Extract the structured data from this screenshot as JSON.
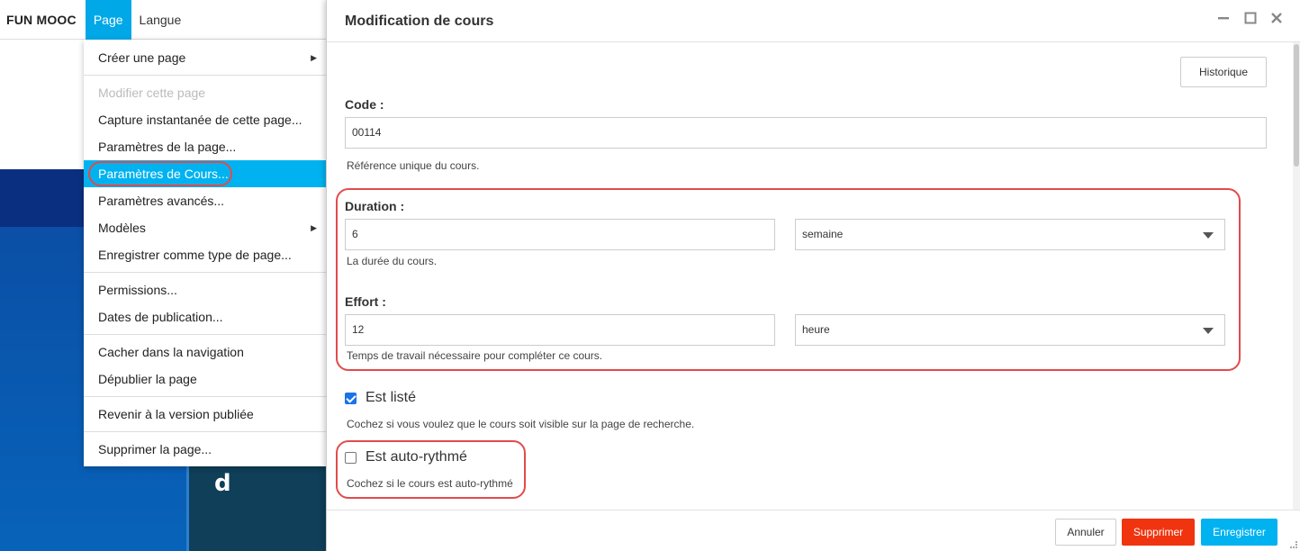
{
  "toolbar": {
    "brand": "FUN MOOC",
    "items": [
      {
        "label": "Page",
        "active": true
      },
      {
        "label": "Langue",
        "active": false
      }
    ]
  },
  "background": {
    "letter": "d"
  },
  "menu": {
    "items": [
      {
        "label": "Créer une page",
        "submenu": true
      },
      {
        "label": "Modifier cette page",
        "disabled": true
      },
      {
        "label": "Capture instantanée de cette page..."
      },
      {
        "label": "Paramètres de la page..."
      },
      {
        "label": "Paramètres de Cours...",
        "selected": true
      },
      {
        "label": "Paramètres avancés..."
      },
      {
        "label": "Modèles",
        "submenu": true
      },
      {
        "label": "Enregistrer comme type de page..."
      },
      {
        "label": "Permissions..."
      },
      {
        "label": "Dates de publication..."
      },
      {
        "label": "Cacher dans la navigation"
      },
      {
        "label": "Dépublier la page"
      },
      {
        "label": "Revenir à la version publiée"
      },
      {
        "label": "Supprimer la page..."
      }
    ]
  },
  "modal": {
    "title": "Modification de cours",
    "history_button": "Historique",
    "code": {
      "label": "Code :",
      "value": "00114",
      "help": "Référence unique du cours."
    },
    "duration": {
      "label": "Duration :",
      "value": "6",
      "unit": "semaine",
      "help": "La durée du cours."
    },
    "effort": {
      "label": "Effort :",
      "value": "12",
      "unit": "heure",
      "help": "Temps de travail nécessaire pour compléter ce cours."
    },
    "is_listed": {
      "label": "Est listé",
      "checked": true,
      "help": "Cochez si vous voulez que le cours soit visible sur la page de recherche."
    },
    "is_self_paced": {
      "label": "Est auto-rythmé",
      "checked": false,
      "help": "Cochez si le cours est auto-rythmé"
    },
    "footer": {
      "cancel": "Annuler",
      "delete": "Supprimer",
      "save": "Enregistrer"
    }
  },
  "colors": {
    "accent": "#00b2f0",
    "danger": "#f0340f",
    "highlight": "#e24b4b",
    "checkbox": "#1a73e8"
  }
}
